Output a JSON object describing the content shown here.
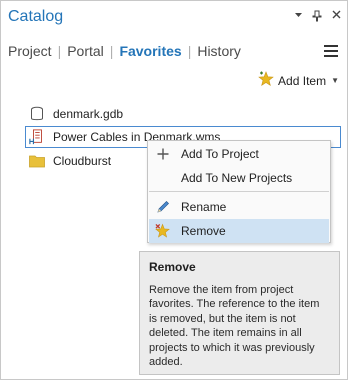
{
  "pane": {
    "title": "Catalog",
    "title_icons": [
      "chevron-down-icon",
      "pin-icon",
      "close-icon"
    ]
  },
  "tabs": [
    {
      "label": "Project",
      "active": false
    },
    {
      "label": "Portal",
      "active": false
    },
    {
      "label": "Favorites",
      "active": true
    },
    {
      "label": "History",
      "active": false
    }
  ],
  "toolbar": {
    "add_item_label": "Add Item"
  },
  "tree": [
    {
      "label": "denmark.gdb",
      "icon": "database-icon"
    },
    {
      "label": "Power Cables in Denmark.wms",
      "icon": "wms-service-icon",
      "selected": true
    },
    {
      "label": "Cloudburst",
      "icon": "folder-icon"
    }
  ],
  "context_menu": {
    "items": [
      {
        "label": "Add To Project",
        "icon": "plus-icon"
      },
      {
        "label": "Add To New Projects",
        "icon": ""
      },
      {
        "label": "Rename",
        "icon": "pencil-icon"
      },
      {
        "label": "Remove",
        "icon": "remove-favorite-icon",
        "hover": true
      }
    ]
  },
  "tooltip": {
    "title": "Remove",
    "body": "Remove the item from project favorites. The reference to the item is removed, but the item is not deleted. The item remains in all projects to which it was previously added."
  },
  "colors": {
    "accent": "#2475b8",
    "hover": "#cfe2f3",
    "folder": "#e8c03a",
    "star": "#e8b820"
  }
}
